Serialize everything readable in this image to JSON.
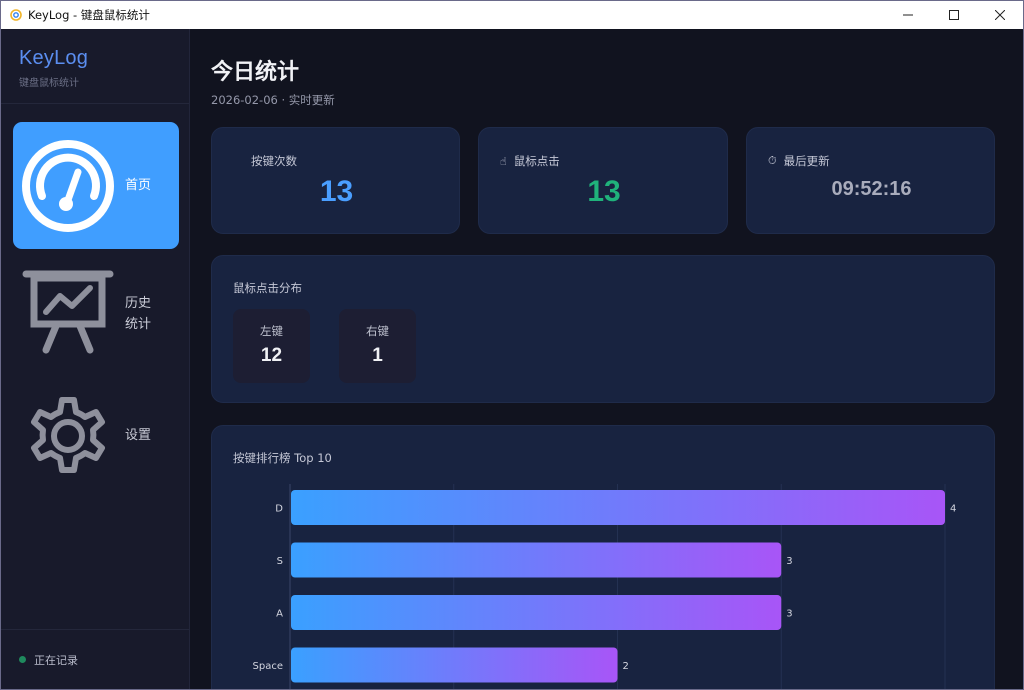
{
  "window": {
    "title": "KeyLog - 键盘鼠标统计",
    "controls": {
      "minimize": "—",
      "maximize": "☐",
      "close": "✕"
    }
  },
  "sidebar": {
    "brand_name": "KeyLog",
    "brand_sub": "键盘鼠标统计",
    "items": [
      {
        "label": "首页",
        "icon": "dashboard-gauge-icon",
        "active": true
      },
      {
        "label": "历史统计",
        "icon": "presentation-chart-icon",
        "active": false
      },
      {
        "label": "设置",
        "icon": "gear-icon",
        "active": false
      }
    ],
    "status": "正在记录",
    "status_color": "#1f8a5e"
  },
  "main": {
    "title": "今日统计",
    "subtitle": "2026-02-06 · 实时更新",
    "stats": [
      {
        "label": "按键次数",
        "value": "13",
        "icon": "",
        "color": "#4a9eff"
      },
      {
        "label": "鼠标点击",
        "value": "13",
        "icon": "pointer-hand-icon",
        "color": "#20b27b"
      },
      {
        "label": "最后更新",
        "value": "09:52:16",
        "icon": "stopwatch-icon",
        "color": "#a9acbc"
      }
    ],
    "click_dist": {
      "title": "鼠标点击分布",
      "left_label": "左键",
      "left_value": "12",
      "right_label": "右键",
      "right_value": "1"
    },
    "ranking_title": "按键排行榜 Top 10"
  },
  "chart_data": {
    "type": "bar",
    "orientation": "horizontal",
    "categories": [
      "D",
      "S",
      "A",
      "Space"
    ],
    "values": [
      4,
      3,
      3,
      2
    ],
    "xlim": [
      0,
      4
    ],
    "grid": true,
    "gradient": [
      "#3aa0ff",
      "#a855f7"
    ]
  }
}
